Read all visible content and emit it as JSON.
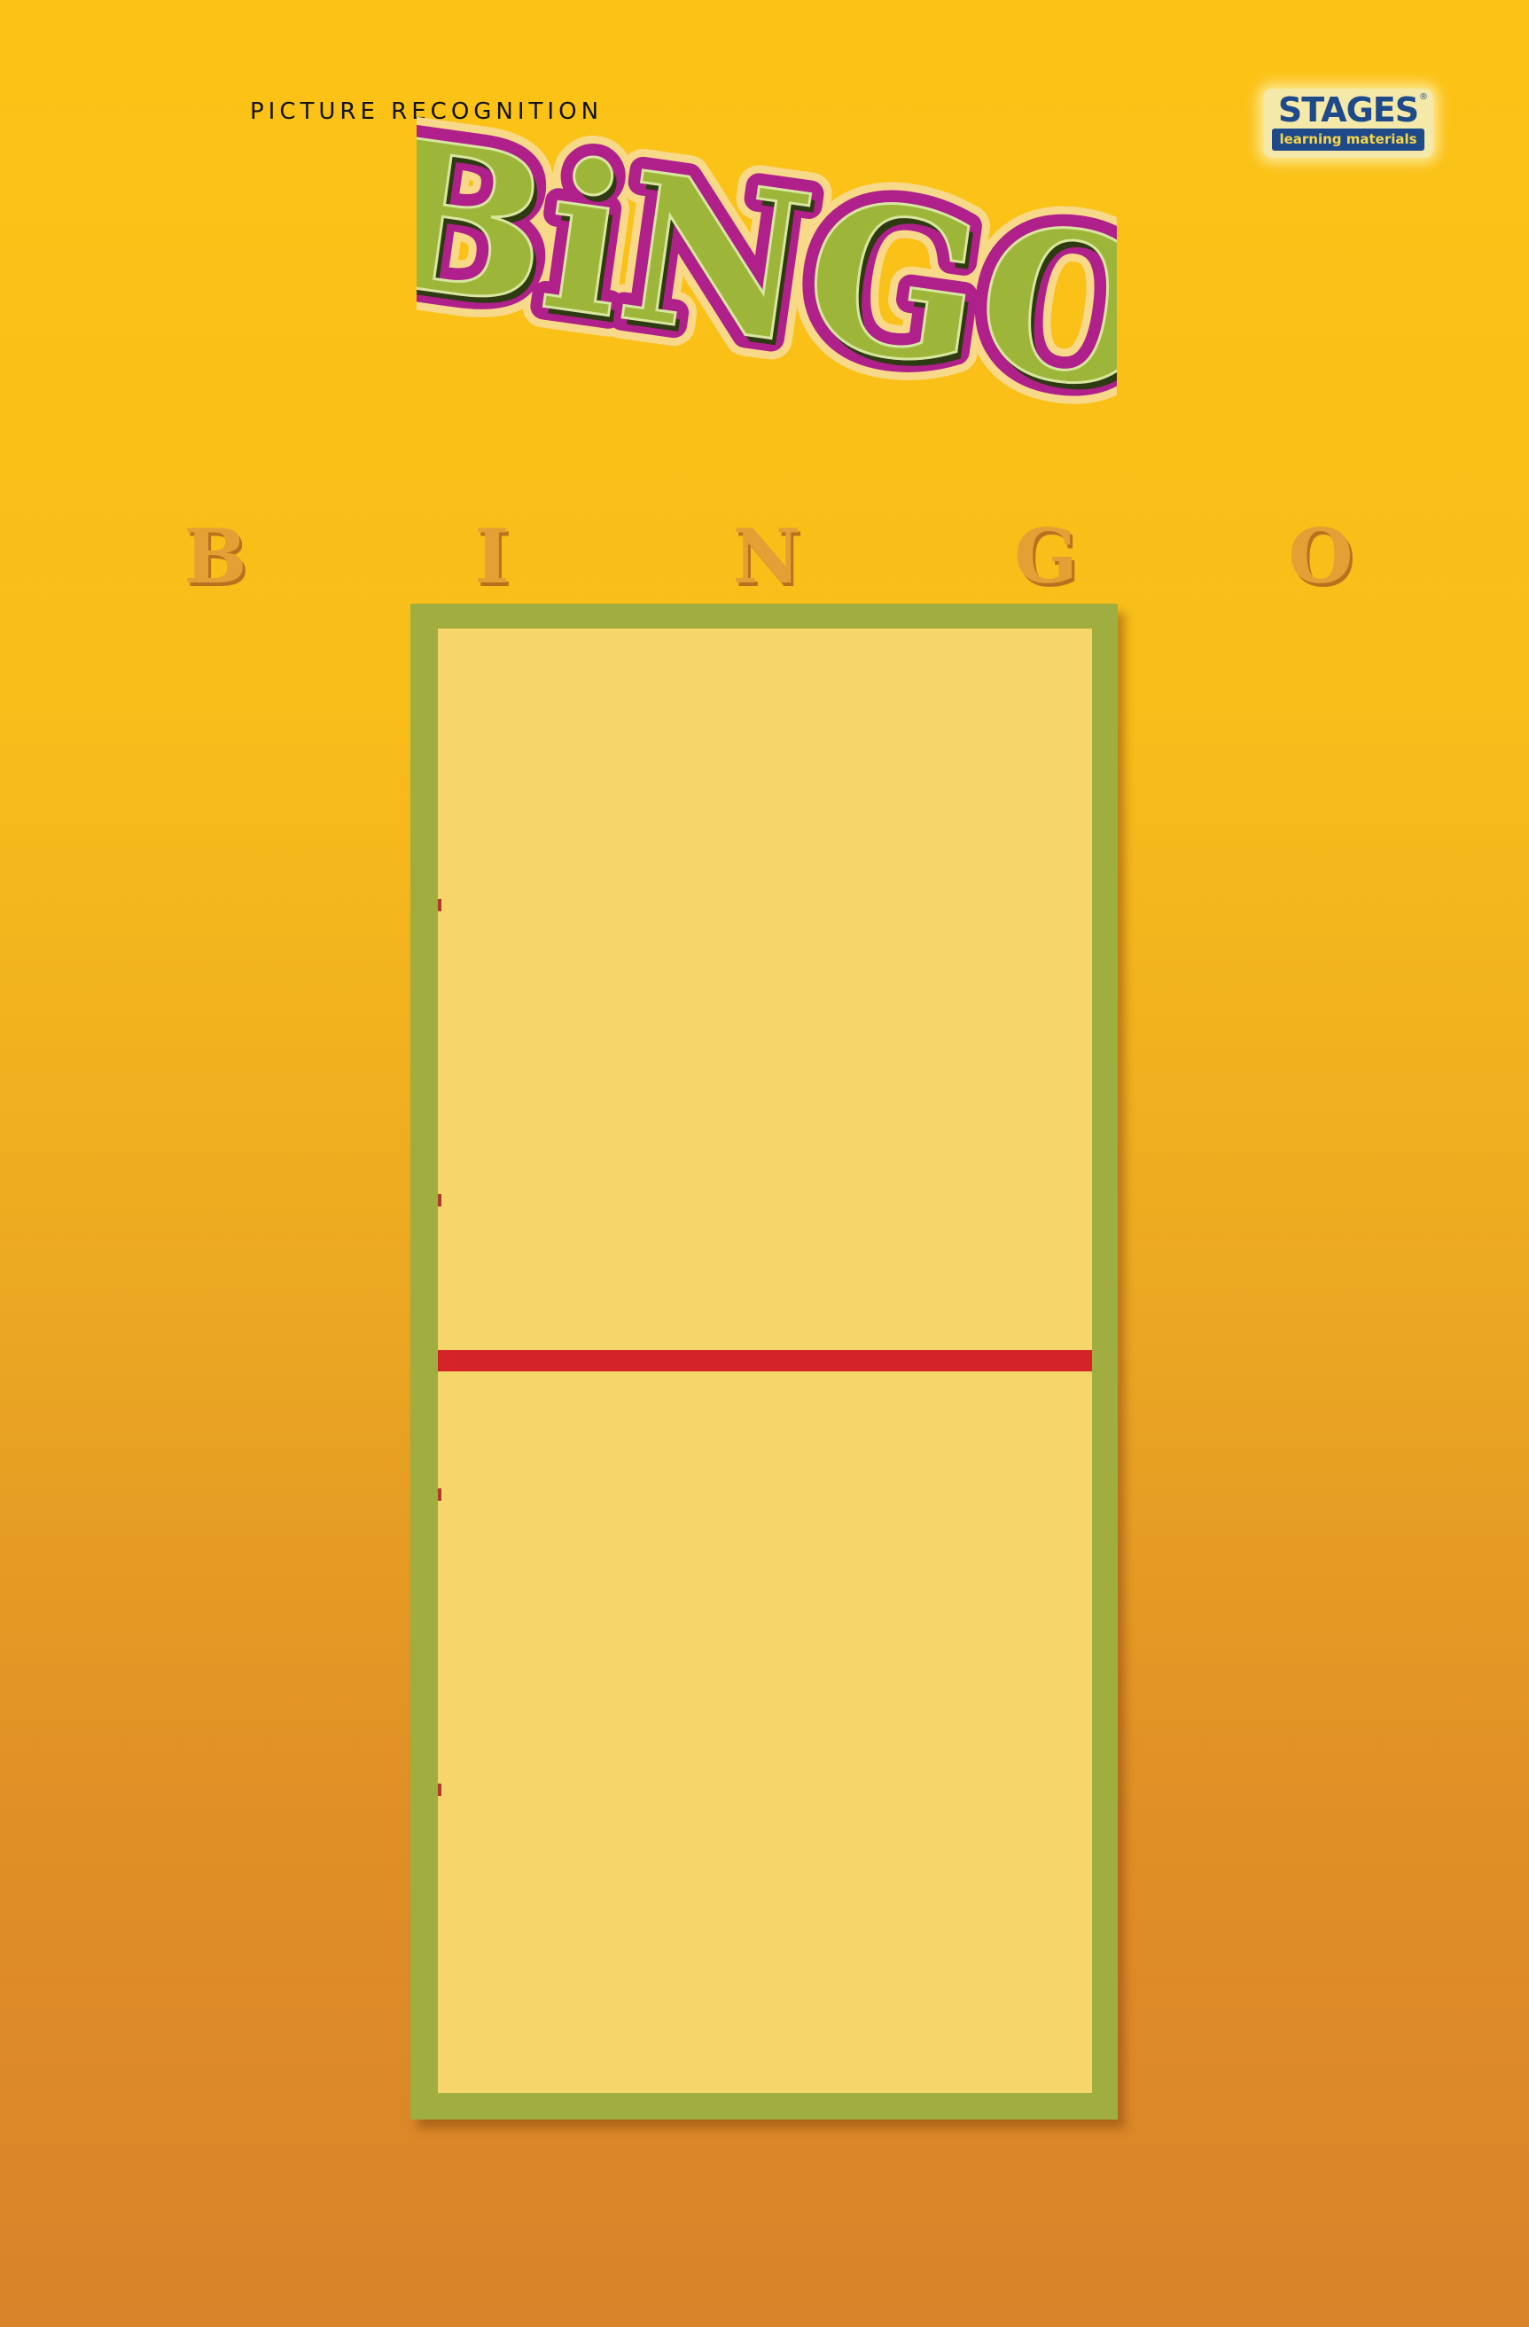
{
  "header": {
    "subtitle": "PICTURE RECOGNITION",
    "logo_text": "BiNGO",
    "brand": {
      "name": "STAGES",
      "registered_mark": "®",
      "tagline": "learning materials"
    }
  },
  "board": {
    "column_letters": [
      "B",
      "I",
      "N",
      "G",
      "O"
    ]
  },
  "colors": {
    "background_top": "#FCC316",
    "background_bottom": "#D9832A",
    "board_frame": "#A0AE3F",
    "board_fill": "#F6D66A",
    "center_bar": "#D42428",
    "logo_fill": "#9DB63A",
    "logo_outline": "#B0208A",
    "column_letter": "#E3A035",
    "brand_blue": "#1E4A8A"
  }
}
